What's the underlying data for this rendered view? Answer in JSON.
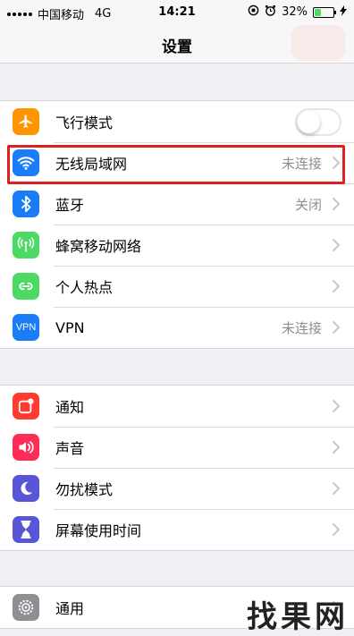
{
  "status_bar": {
    "carrier": "中国移动",
    "network": "4G",
    "time": "14:21",
    "battery": "32%",
    "battery_level": 0.32
  },
  "nav": {
    "title": "设置"
  },
  "group1": [
    {
      "label": "飞行模式",
      "icon": "airplane-icon",
      "icon_color": "#ff9500",
      "control": "toggle",
      "on": false
    },
    {
      "label": "无线局域网",
      "icon": "wifi-icon",
      "icon_color": "#1a7cf6",
      "value": "未连接",
      "highlighted": true
    },
    {
      "label": "蓝牙",
      "icon": "bluetooth-icon",
      "icon_color": "#1a7cf6",
      "value": "关闭"
    },
    {
      "label": "蜂窝移动网络",
      "icon": "antenna-icon",
      "icon_color": "#4cd964",
      "value": ""
    },
    {
      "label": "个人热点",
      "icon": "hotspot-icon",
      "icon_color": "#4cd964",
      "value": ""
    },
    {
      "label": "VPN",
      "icon": "vpn-icon",
      "icon_text": "VPN",
      "icon_color": "#1a7cf6",
      "value": "未连接"
    }
  ],
  "group2": [
    {
      "label": "通知",
      "icon": "notification-icon",
      "icon_color": "#ff3b30"
    },
    {
      "label": "声音",
      "icon": "speaker-icon",
      "icon_color": "#ff2d55"
    },
    {
      "label": "勿扰模式",
      "icon": "moon-icon",
      "icon_color": "#5856d6"
    },
    {
      "label": "屏幕使用时间",
      "icon": "hourglass-icon",
      "icon_color": "#5856d6"
    }
  ],
  "group3": [
    {
      "label": "通用",
      "icon": "gear-icon",
      "icon_color": "#8e8e93"
    }
  ],
  "watermark": "找果网"
}
